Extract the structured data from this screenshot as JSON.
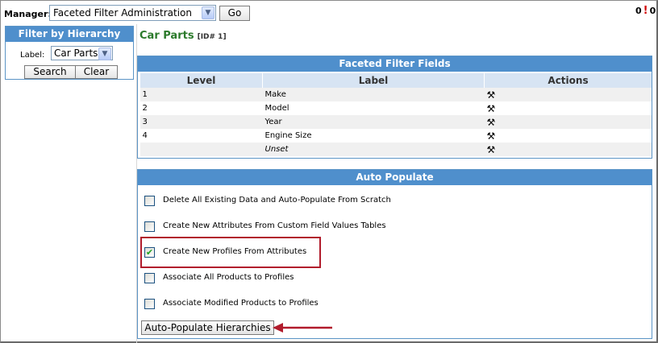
{
  "topbar": {
    "manager_label": "Manager:",
    "manager_value": "Faceted Filter Administration",
    "go_label": "Go",
    "status_count_a": "0",
    "status_count_b": "0"
  },
  "filter": {
    "title": "Filter by Hierarchy",
    "label_text": "Label:",
    "label_value": "Car Parts",
    "search_label": "Search",
    "clear_label": "Clear"
  },
  "page": {
    "title": "Car Parts",
    "id_text": "[ID# 1]"
  },
  "fields": {
    "title": "Faceted Filter Fields",
    "columns": [
      "Level",
      "Label",
      "Actions"
    ],
    "rows": [
      {
        "level": "1",
        "label": "Make"
      },
      {
        "level": "2",
        "label": "Model"
      },
      {
        "level": "3",
        "label": "Year"
      },
      {
        "level": "4",
        "label": "Engine Size"
      },
      {
        "level": "",
        "label": "Unset"
      }
    ]
  },
  "auto_populate": {
    "title": "Auto Populate",
    "options": [
      {
        "label": "Delete All Existing Data and Auto-Populate From Scratch",
        "checked": false
      },
      {
        "label": "Create New Attributes From Custom Field Values Tables",
        "checked": false
      },
      {
        "label": "Create New Profiles From Attributes",
        "checked": true
      },
      {
        "label": "Associate All Products to Profiles",
        "checked": false
      },
      {
        "label": "Associate Modified Products to Profiles",
        "checked": false
      }
    ],
    "button_label": "Auto-Populate Hierarchies"
  },
  "colors": {
    "header_blue": "#4f8fcc",
    "title_green": "#2b7a2b",
    "highlight_red": "#b11c2c"
  }
}
